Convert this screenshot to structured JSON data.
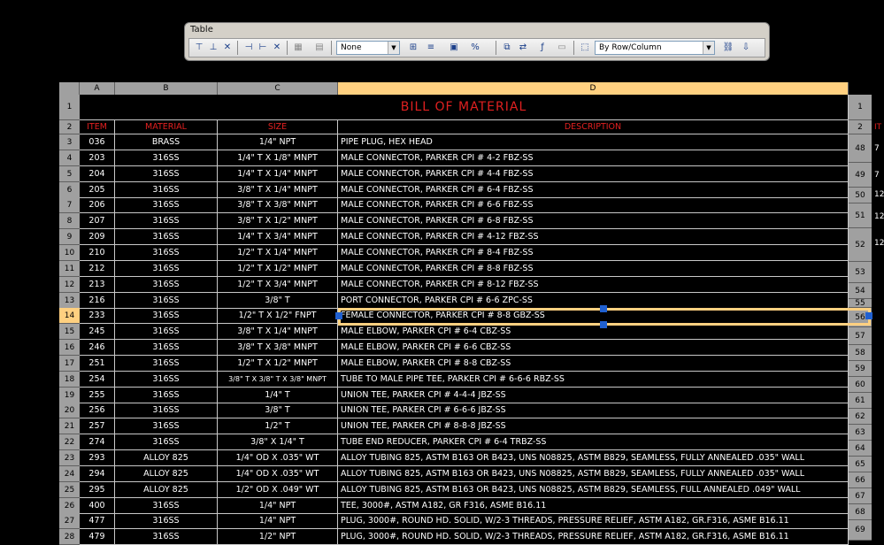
{
  "toolbar": {
    "title": "Table",
    "cell_style": "None",
    "match_mode": "By Row/Column"
  },
  "columns": [
    "A",
    "B",
    "C",
    "D"
  ],
  "title": "BILL OF MATERIAL",
  "header_row": {
    "item": "ITEM",
    "material": "MATERIAL",
    "size": "SIZE",
    "description": "DESCRIPTION"
  },
  "rows": [
    {
      "n": "3",
      "item": "036",
      "material": "BRASS",
      "size": "1/4\" NPT",
      "description": "PIPE PLUG, HEX HEAD"
    },
    {
      "n": "4",
      "item": "203",
      "material": "316SS",
      "size": "1/4\" T X 1/8\" MNPT",
      "description": "MALE CONNECTOR, PARKER CPI # 4-2 FBZ-SS"
    },
    {
      "n": "5",
      "item": "204",
      "material": "316SS",
      "size": "1/4\" T X 1/4\" MNPT",
      "description": "MALE CONNECTOR, PARKER CPI # 4-4 FBZ-SS"
    },
    {
      "n": "6",
      "item": "205",
      "material": "316SS",
      "size": "3/8\" T X 1/4\" MNPT",
      "description": "MALE CONNECTOR, PARKER CPI # 6-4 FBZ-SS"
    },
    {
      "n": "7",
      "item": "206",
      "material": "316SS",
      "size": "3/8\" T X 3/8\" MNPT",
      "description": "MALE CONNECTOR, PARKER CPI # 6-6 FBZ-SS"
    },
    {
      "n": "8",
      "item": "207",
      "material": "316SS",
      "size": "3/8\" T X 1/2\" MNPT",
      "description": "MALE CONNECTOR, PARKER CPI # 6-8 FBZ-SS"
    },
    {
      "n": "9",
      "item": "209",
      "material": "316SS",
      "size": "1/4\" T X 3/4\" MNPT",
      "description": "MALE CONNECTOR, PARKER CPI # 4-12 FBZ-SS"
    },
    {
      "n": "10",
      "item": "210",
      "material": "316SS",
      "size": "1/2\" T X 1/4\" MNPT",
      "description": "MALE CONNECTOR, PARKER CPI # 8-4 FBZ-SS"
    },
    {
      "n": "11",
      "item": "212",
      "material": "316SS",
      "size": "1/2\" T X 1/2\" MNPT",
      "description": "MALE CONNECTOR, PARKER CPI # 8-8 FBZ-SS"
    },
    {
      "n": "12",
      "item": "213",
      "material": "316SS",
      "size": "1/2\" T X 3/4\" MNPT",
      "description": "MALE CONNECTOR, PARKER CPI # 8-12 FBZ-SS"
    },
    {
      "n": "13",
      "item": "216",
      "material": "316SS",
      "size": "3/8\" T",
      "description": "PORT CONNECTOR, PARKER CPI # 6-6 ZPC-SS"
    },
    {
      "n": "14",
      "item": "233",
      "material": "316SS",
      "size": "1/2\" T X 1/2\" FNPT",
      "description": "FEMALE CONNECTOR, PARKER CPI # 8-8 GBZ-SS"
    },
    {
      "n": "15",
      "item": "245",
      "material": "316SS",
      "size": "3/8\" T X 1/4\" MNPT",
      "description": "MALE ELBOW, PARKER CPI # 6-4 CBZ-SS"
    },
    {
      "n": "16",
      "item": "246",
      "material": "316SS",
      "size": "3/8\" T X 3/8\" MNPT",
      "description": "MALE ELBOW, PARKER CPI # 6-6 CBZ-SS"
    },
    {
      "n": "17",
      "item": "251",
      "material": "316SS",
      "size": "1/2\" T X 1/2\" MNPT",
      "description": "MALE ELBOW, PARKER CPI # 8-8 CBZ-SS"
    },
    {
      "n": "18",
      "item": "254",
      "material": "316SS",
      "size": "3/8\" T X 3/8\" T X 3/8\" MNPT",
      "description": "TUBE TO MALE PIPE TEE, PARKER CPI # 6-6-6 RBZ-SS"
    },
    {
      "n": "19",
      "item": "255",
      "material": "316SS",
      "size": "1/4\" T",
      "description": "UNION TEE, PARKER CPI # 4-4-4 JBZ-SS"
    },
    {
      "n": "20",
      "item": "256",
      "material": "316SS",
      "size": "3/8\" T",
      "description": "UNION TEE, PARKER CPI # 6-6-6 JBZ-SS"
    },
    {
      "n": "21",
      "item": "257",
      "material": "316SS",
      "size": "1/2\" T",
      "description": "UNION TEE, PARKER CPI # 8-8-8 JBZ-SS"
    },
    {
      "n": "22",
      "item": "274",
      "material": "316SS",
      "size": "3/8\" X 1/4\" T",
      "description": "TUBE END REDUCER, PARKER CPI # 6-4 TRBZ-SS"
    },
    {
      "n": "23",
      "item": "293",
      "material": "ALLOY 825",
      "size": "1/4\" OD X .035\" WT",
      "description": "ALLOY TUBING 825, ASTM B163 OR B423, UNS N08825, ASTM B829, SEAMLESS, FULLY ANNEALED .035\" WALL"
    },
    {
      "n": "24",
      "item": "294",
      "material": "ALLOY 825",
      "size": "1/4\" OD X .035\" WT",
      "description": "ALLOY TUBING 825, ASTM B163 OR B423, UNS N08825, ASTM B829, SEAMLESS, FULLY ANNEALED .035\" WALL"
    },
    {
      "n": "25",
      "item": "295",
      "material": "ALLOY 825",
      "size": "1/2\" OD X .049\" WT",
      "description": "ALLOY TUBING 825, ASTM B163 OR B423, UNS N08825, ASTM B829, SEAMLESS, FULL ANNEALED .049\" WALL"
    },
    {
      "n": "26",
      "item": "400",
      "material": "316SS",
      "size": "1/4\" NPT",
      "description": "TEE, 3000#, ASTM A182, GR F316, ASME B16.11"
    },
    {
      "n": "27",
      "item": "477",
      "material": "316SS",
      "size": "1/4\" NPT",
      "description": "PLUG, 3000#, ROUND HD. SOLID, W/2-3 THREADS, PRESSURE RELIEF, ASTM A182, GR.F316, ASME B16.11"
    },
    {
      "n": "28",
      "item": "479",
      "material": "316SS",
      "size": "1/2\" NPT",
      "description": "PLUG, 3000#, ROUND HD. SOLID, W/2-3 THREADS, PRESSURE RELIEF, ASTM A182, GR.F316, ASME B16.11"
    }
  ],
  "right_rows": [
    "1",
    "2",
    "48",
    "49",
    "50",
    "51",
    "52",
    "53",
    "54",
    "55",
    "56",
    "57",
    "58",
    "59",
    "60",
    "61",
    "62",
    "63",
    "64",
    "65",
    "66",
    "67",
    "68",
    "69"
  ],
  "right_text": [
    "IT",
    "7",
    "7",
    "12",
    "12",
    "12"
  ]
}
